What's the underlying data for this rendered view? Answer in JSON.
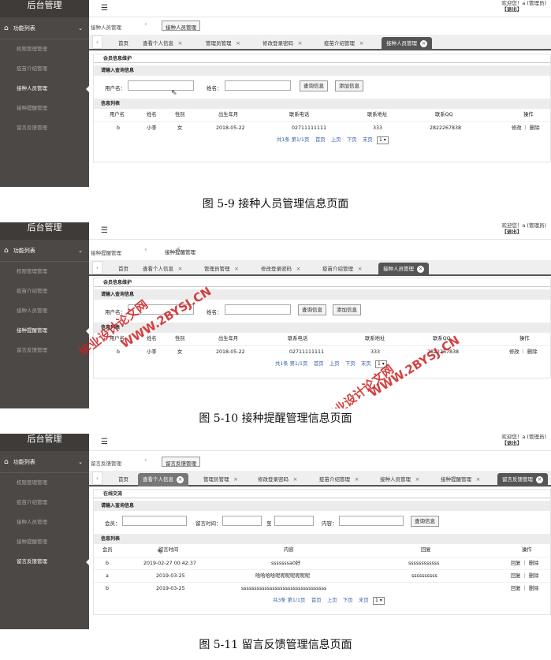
{
  "panels": [
    {
      "logo": "后台管理",
      "welcome": "欢迎您！a (管理员)",
      "logout": "【退出】",
      "side_head": "功能列表",
      "menu": [
        "权限管理管理",
        "疫苗介绍管理",
        "接种人员管理",
        "接种提醒管理",
        "留言反馈管理"
      ],
      "active_menu": 2,
      "crumb": "接种人员管理",
      "crumb_button": "接种人员管理",
      "tabs": [
        "首页",
        "查看个人信息",
        "管理员管理",
        "修改登录密码",
        "疫苗介绍管理",
        "接种人员管理"
      ],
      "active_tab": 5,
      "section_title": "会员信息维护",
      "query_bar": "请输入查询信息",
      "fields": [
        "用户名：",
        "姓名："
      ],
      "buttons": [
        "查询信息",
        "添加信息"
      ],
      "list_bar": "信息列表",
      "columns": [
        "用户名",
        "姓名",
        "性别",
        "出生年月",
        "联系电话",
        "联系地址",
        "联系QQ",
        "操作"
      ],
      "rows": [
        [
          "b",
          "小李",
          "女",
          "2018-05-22",
          "02711111111",
          "333",
          "2822267838",
          "修改 ｜ 删除"
        ]
      ],
      "pager": [
        "共1条 第1/1页",
        "首页",
        "上页",
        "下页",
        "末页",
        "1 ▾"
      ],
      "caption": "图 5-9 接种人员管理信息页面"
    },
    {
      "logo": "后台管理",
      "welcome": "欢迎您！a (管理员)",
      "logout": "【退出】",
      "side_head": "功能列表",
      "menu": [
        "权限管理管理",
        "疫苗介绍管理",
        "接种人员管理",
        "接种提醒管理",
        "留言反馈管理"
      ],
      "active_menu": 3,
      "crumb": "接种提醒管理",
      "crumb_button": "接种提醒管理",
      "tabs": [
        "首页",
        "查看个人信息",
        "管理员管理",
        "修改登录密码",
        "疫苗介绍管理",
        "接种人员管理"
      ],
      "active_tab": 5,
      "section_title": "会员信息维护",
      "query_bar": "请输入查询信息",
      "fields": [
        "用户名：",
        "姓名："
      ],
      "buttons": [
        "查询信息",
        "添加信息"
      ],
      "list_bar": "信息列表",
      "columns": [
        "用户名",
        "姓名",
        "性别",
        "出生年月",
        "联系电话",
        "联系地址",
        "联系QQ",
        "操作"
      ],
      "rows": [
        [
          "b",
          "小李",
          "女",
          "2018-05-22",
          "02711111111",
          "333",
          "2822267838",
          "修改 ｜ 删除"
        ]
      ],
      "pager": [
        "共1条 第1/1页",
        "首页",
        "上页",
        "下页",
        "末页",
        "1 ▾"
      ],
      "caption": "图 5-10 接种提醒管理信息页面",
      "watermarks": [
        "毕业设计论文网",
        "WWW.2BYSJ.CN"
      ]
    },
    {
      "logo": "后台管理",
      "welcome": "欢迎您！a (管理员)",
      "logout": "【退出】",
      "side_head": "功能列表",
      "menu": [
        "权限管理管理",
        "疫苗介绍管理",
        "接种人员管理",
        "接种提醒管理",
        "留言反馈管理"
      ],
      "active_menu": 4,
      "crumb": "留言反馈管理",
      "crumb_button": "留言反馈管理",
      "tabs": [
        "首页",
        "查看个人信息",
        "管理员管理",
        "修改登录密码",
        "疫苗介绍管理",
        "接种人员管理",
        "接种提醒管理",
        "留言反馈管理"
      ],
      "active_tab": 7,
      "section_title": "在线交流",
      "query_bar": "请输入查询信息",
      "fields": [
        "会员：",
        "留言时间：",
        "至",
        "内容："
      ],
      "buttons": [
        "查询信息"
      ],
      "list_bar": "信息列表",
      "columns": [
        "会员",
        "留言时间",
        "内容",
        "回复",
        "操作"
      ],
      "rows": [
        [
          "b",
          "2019-02-27 00:42:37",
          "sssssssa0好",
          "ssssssssssss",
          "回复 ｜ 删除"
        ],
        [
          "a",
          "2019-03-25",
          "哈哈哈哈呢呢呢呢呢呢呢",
          "ssssssssss",
          "回复 ｜ 删除"
        ],
        [
          "b",
          "2019-03-25",
          "sssssssssssssssssssssssssssssssss",
          "",
          "回复 ｜ 删除"
        ]
      ],
      "pager": [
        "共3条 第1/1页",
        "首页",
        "上页",
        "下页",
        "末页",
        "1 ▾"
      ],
      "caption": "图 5-11 留言反馈管理信息页面"
    }
  ]
}
